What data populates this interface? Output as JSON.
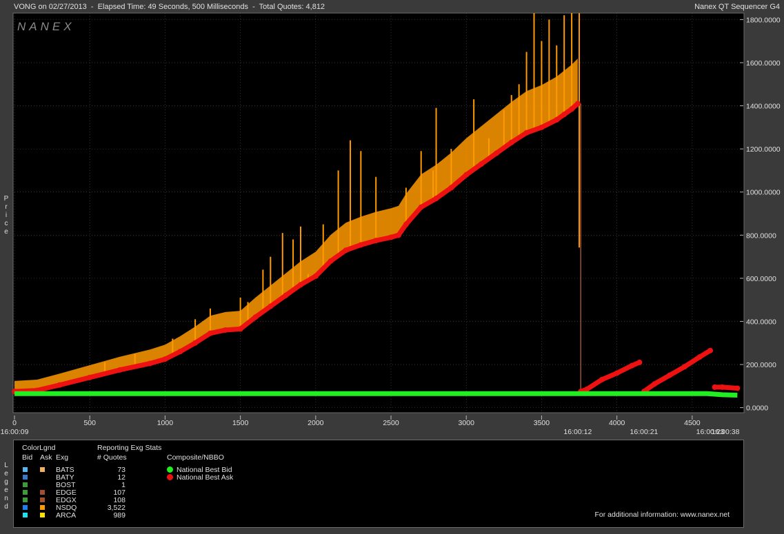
{
  "header": {
    "title": "VONG on 02/27/2013  -  Elapsed Time: 49 Seconds, 500 Milliseconds  -  Total Quotes: 4,812",
    "app_name": "Nanex QT Sequencer G4",
    "logo_text": "NANEX"
  },
  "side_labels": {
    "price": "Price",
    "legend": "Legend"
  },
  "legend": {
    "color_legend_title": "ColorLgnd",
    "col_bid": "Bid",
    "col_ask": "Ask",
    "col_exg": "Exg",
    "stats_title": "Reporting Exg Stats",
    "stats_col": "# Quotes",
    "composite_title": "Composite/NBBO",
    "exchanges": [
      {
        "name": "BATS",
        "quotes": "73",
        "bid_color": "#5ab4f0",
        "ask_color": "#f0b060"
      },
      {
        "name": "BATY",
        "quotes": "12",
        "bid_color": "#3a78c8",
        "ask_color": ""
      },
      {
        "name": "BOST",
        "quotes": "1",
        "bid_color": "#3c9c3c",
        "ask_color": ""
      },
      {
        "name": "EDGE",
        "quotes": "107",
        "bid_color": "#3c9c3c",
        "ask_color": "#a05030"
      },
      {
        "name": "EDGX",
        "quotes": "108",
        "bid_color": "#3c9c3c",
        "ask_color": "#a05030"
      },
      {
        "name": "NSDQ",
        "quotes": "3,522",
        "bid_color": "#1e7ef0",
        "ask_color": "#ff9a00"
      },
      {
        "name": "ARCA",
        "quotes": "989",
        "bid_color": "#20e0f0",
        "ask_color": "#ffe000"
      }
    ],
    "nbbo": [
      {
        "label": "National Best Bid",
        "color": "#22ee22"
      },
      {
        "label": "National Best Ask",
        "color": "#ee1111"
      }
    ],
    "footer": "For additional information: www.nanex.net"
  },
  "colors": {
    "background": "#000000",
    "frame": "#3a3a3a",
    "grid": "#555555",
    "orange": "#ff9a00",
    "yellow": "#ffcc00",
    "red": "#ee1111",
    "green": "#22ee22",
    "brown": "#a05030"
  },
  "chart_data": {
    "type": "scatter",
    "title": "",
    "xlabel": "",
    "ylabel": "Price",
    "xlim": [
      0,
      4812
    ],
    "ylim": [
      -30,
      1830
    ],
    "x_ticks": [
      0,
      500,
      1000,
      1500,
      2000,
      2500,
      3000,
      3500,
      4000,
      4500
    ],
    "x_tick_labels": [
      "0",
      "500",
      "1000",
      "1500",
      "2000",
      "2500",
      "3000",
      "3500",
      "4000",
      "4500"
    ],
    "y_ticks": [
      0,
      200,
      400,
      600,
      800,
      1000,
      1200,
      1400,
      1600,
      1800
    ],
    "y_tick_labels": [
      "0.0000",
      "200.0000",
      "400.0000",
      "600.0000",
      "800.0000",
      "1000.0000",
      "1200.0000",
      "1400.0000",
      "1600.0000",
      "1800.0000"
    ],
    "time_labels": [
      {
        "x": 0,
        "label": "16:00:09"
      },
      {
        "x": 3740,
        "label": "16:00:12"
      },
      {
        "x": 4180,
        "label": "16:00:21"
      },
      {
        "x": 4620,
        "label": "16:00:23"
      },
      {
        "x": 4790,
        "label": "16:00:38"
      }
    ],
    "grid": true,
    "series": [
      {
        "name": "National Best Ask",
        "color": "#ee1111",
        "x": [
          0,
          150,
          300,
          500,
          700,
          900,
          1000,
          1100,
          1200,
          1300,
          1400,
          1500,
          1600,
          1700,
          1800,
          1900,
          2000,
          2100,
          2200,
          2300,
          2400,
          2500,
          2550,
          2600,
          2700,
          2800,
          2900,
          3000,
          3100,
          3200,
          3300,
          3400,
          3500,
          3600,
          3650,
          3700,
          3740,
          3760,
          3800,
          3900,
          4000,
          4100,
          4150,
          4180,
          4250,
          4350,
          4450,
          4550,
          4620,
          4650,
          4700,
          4800
        ],
        "y": [
          75,
          80,
          105,
          140,
          175,
          205,
          225,
          260,
          300,
          345,
          360,
          365,
          420,
          470,
          520,
          570,
          610,
          680,
          730,
          755,
          775,
          790,
          800,
          850,
          930,
          970,
          1020,
          1080,
          1130,
          1180,
          1230,
          1275,
          1300,
          1335,
          1360,
          1385,
          1410,
          75,
          85,
          130,
          160,
          195,
          210,
          75,
          110,
          150,
          190,
          235,
          265,
          95,
          95,
          90
        ]
      },
      {
        "name": "National Best Bid",
        "color": "#22ee22",
        "x": [
          0,
          500,
          1000,
          1500,
          2000,
          2500,
          3000,
          3500,
          3760,
          4000,
          4200,
          4400,
          4600,
          4700,
          4800
        ],
        "y": [
          65,
          65,
          65,
          65,
          65,
          65,
          65,
          65,
          65,
          65,
          65,
          65,
          65,
          60,
          58
        ]
      }
    ],
    "ask_spikes": {
      "color": "#ff9a00",
      "x": [
        400,
        600,
        800,
        1050,
        1200,
        1300,
        1500,
        1550,
        1650,
        1700,
        1780,
        1850,
        1900,
        1950,
        2050,
        2150,
        2230,
        2300,
        2400,
        2600,
        2700,
        2780,
        2800,
        2900,
        3050,
        3150,
        3250,
        3300,
        3350,
        3400,
        3450,
        3500,
        3550,
        3600,
        3650,
        3700,
        3750
      ],
      "y": [
        130,
        210,
        250,
        320,
        410,
        460,
        510,
        490,
        640,
        700,
        810,
        780,
        840,
        620,
        850,
        1100,
        1240,
        1190,
        1070,
        1020,
        1190,
        1100,
        1390,
        1200,
        1430,
        1250,
        1380,
        1450,
        1500,
        1650,
        1830,
        1700,
        1800,
        1680,
        1820,
        1830,
        1830
      ]
    },
    "drop": {
      "x": 3760,
      "from": 1410,
      "to": 75
    }
  }
}
